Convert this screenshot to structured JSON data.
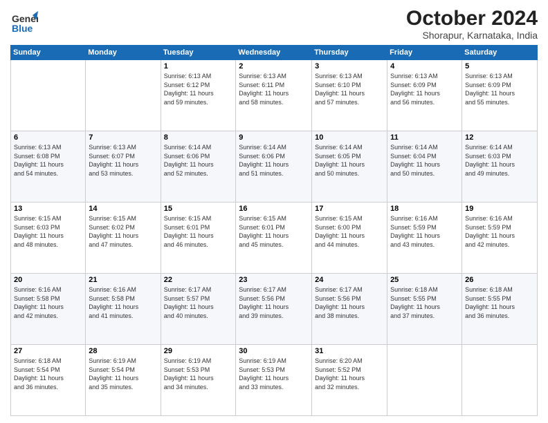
{
  "header": {
    "logo_line1": "General",
    "logo_line2": "Blue",
    "month": "October 2024",
    "location": "Shorapur, Karnataka, India"
  },
  "weekdays": [
    "Sunday",
    "Monday",
    "Tuesday",
    "Wednesday",
    "Thursday",
    "Friday",
    "Saturday"
  ],
  "weeks": [
    [
      {
        "day": "",
        "info": ""
      },
      {
        "day": "",
        "info": ""
      },
      {
        "day": "1",
        "info": "Sunrise: 6:13 AM\nSunset: 6:12 PM\nDaylight: 11 hours\nand 59 minutes."
      },
      {
        "day": "2",
        "info": "Sunrise: 6:13 AM\nSunset: 6:11 PM\nDaylight: 11 hours\nand 58 minutes."
      },
      {
        "day": "3",
        "info": "Sunrise: 6:13 AM\nSunset: 6:10 PM\nDaylight: 11 hours\nand 57 minutes."
      },
      {
        "day": "4",
        "info": "Sunrise: 6:13 AM\nSunset: 6:09 PM\nDaylight: 11 hours\nand 56 minutes."
      },
      {
        "day": "5",
        "info": "Sunrise: 6:13 AM\nSunset: 6:09 PM\nDaylight: 11 hours\nand 55 minutes."
      }
    ],
    [
      {
        "day": "6",
        "info": "Sunrise: 6:13 AM\nSunset: 6:08 PM\nDaylight: 11 hours\nand 54 minutes."
      },
      {
        "day": "7",
        "info": "Sunrise: 6:13 AM\nSunset: 6:07 PM\nDaylight: 11 hours\nand 53 minutes."
      },
      {
        "day": "8",
        "info": "Sunrise: 6:14 AM\nSunset: 6:06 PM\nDaylight: 11 hours\nand 52 minutes."
      },
      {
        "day": "9",
        "info": "Sunrise: 6:14 AM\nSunset: 6:06 PM\nDaylight: 11 hours\nand 51 minutes."
      },
      {
        "day": "10",
        "info": "Sunrise: 6:14 AM\nSunset: 6:05 PM\nDaylight: 11 hours\nand 50 minutes."
      },
      {
        "day": "11",
        "info": "Sunrise: 6:14 AM\nSunset: 6:04 PM\nDaylight: 11 hours\nand 50 minutes."
      },
      {
        "day": "12",
        "info": "Sunrise: 6:14 AM\nSunset: 6:03 PM\nDaylight: 11 hours\nand 49 minutes."
      }
    ],
    [
      {
        "day": "13",
        "info": "Sunrise: 6:15 AM\nSunset: 6:03 PM\nDaylight: 11 hours\nand 48 minutes."
      },
      {
        "day": "14",
        "info": "Sunrise: 6:15 AM\nSunset: 6:02 PM\nDaylight: 11 hours\nand 47 minutes."
      },
      {
        "day": "15",
        "info": "Sunrise: 6:15 AM\nSunset: 6:01 PM\nDaylight: 11 hours\nand 46 minutes."
      },
      {
        "day": "16",
        "info": "Sunrise: 6:15 AM\nSunset: 6:01 PM\nDaylight: 11 hours\nand 45 minutes."
      },
      {
        "day": "17",
        "info": "Sunrise: 6:15 AM\nSunset: 6:00 PM\nDaylight: 11 hours\nand 44 minutes."
      },
      {
        "day": "18",
        "info": "Sunrise: 6:16 AM\nSunset: 5:59 PM\nDaylight: 11 hours\nand 43 minutes."
      },
      {
        "day": "19",
        "info": "Sunrise: 6:16 AM\nSunset: 5:59 PM\nDaylight: 11 hours\nand 42 minutes."
      }
    ],
    [
      {
        "day": "20",
        "info": "Sunrise: 6:16 AM\nSunset: 5:58 PM\nDaylight: 11 hours\nand 42 minutes."
      },
      {
        "day": "21",
        "info": "Sunrise: 6:16 AM\nSunset: 5:58 PM\nDaylight: 11 hours\nand 41 minutes."
      },
      {
        "day": "22",
        "info": "Sunrise: 6:17 AM\nSunset: 5:57 PM\nDaylight: 11 hours\nand 40 minutes."
      },
      {
        "day": "23",
        "info": "Sunrise: 6:17 AM\nSunset: 5:56 PM\nDaylight: 11 hours\nand 39 minutes."
      },
      {
        "day": "24",
        "info": "Sunrise: 6:17 AM\nSunset: 5:56 PM\nDaylight: 11 hours\nand 38 minutes."
      },
      {
        "day": "25",
        "info": "Sunrise: 6:18 AM\nSunset: 5:55 PM\nDaylight: 11 hours\nand 37 minutes."
      },
      {
        "day": "26",
        "info": "Sunrise: 6:18 AM\nSunset: 5:55 PM\nDaylight: 11 hours\nand 36 minutes."
      }
    ],
    [
      {
        "day": "27",
        "info": "Sunrise: 6:18 AM\nSunset: 5:54 PM\nDaylight: 11 hours\nand 36 minutes."
      },
      {
        "day": "28",
        "info": "Sunrise: 6:19 AM\nSunset: 5:54 PM\nDaylight: 11 hours\nand 35 minutes."
      },
      {
        "day": "29",
        "info": "Sunrise: 6:19 AM\nSunset: 5:53 PM\nDaylight: 11 hours\nand 34 minutes."
      },
      {
        "day": "30",
        "info": "Sunrise: 6:19 AM\nSunset: 5:53 PM\nDaylight: 11 hours\nand 33 minutes."
      },
      {
        "day": "31",
        "info": "Sunrise: 6:20 AM\nSunset: 5:52 PM\nDaylight: 11 hours\nand 32 minutes."
      },
      {
        "day": "",
        "info": ""
      },
      {
        "day": "",
        "info": ""
      }
    ]
  ]
}
